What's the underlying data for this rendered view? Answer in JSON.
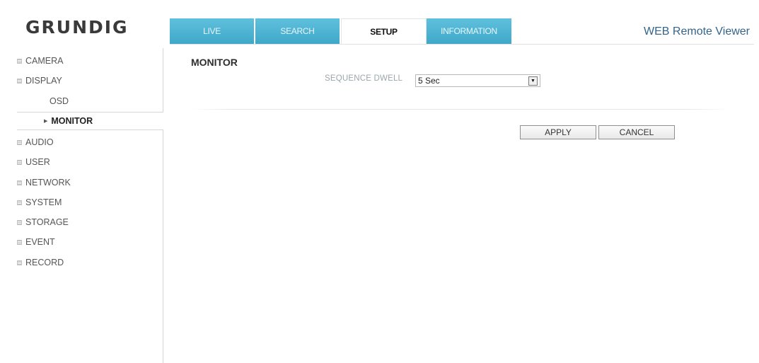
{
  "brand": {
    "logo": "GRUNDIG"
  },
  "header": {
    "tabs": [
      {
        "label": "LIVE",
        "active": false
      },
      {
        "label": "SEARCH",
        "active": false
      },
      {
        "label": "SETUP",
        "active": true
      },
      {
        "label": "INFORMATION",
        "active": false
      }
    ],
    "app_title": "WEB Remote Viewer"
  },
  "sidebar": {
    "items": [
      {
        "label": "CAMERA"
      },
      {
        "label": "DISPLAY",
        "expanded": true
      },
      {
        "label": "AUDIO"
      },
      {
        "label": "USER"
      },
      {
        "label": "NETWORK"
      },
      {
        "label": "SYSTEM"
      },
      {
        "label": "STORAGE"
      },
      {
        "label": "EVENT"
      },
      {
        "label": "RECORD"
      }
    ],
    "display_sub": [
      {
        "label": "OSD",
        "active": false
      },
      {
        "label": "MONITOR",
        "active": true
      }
    ]
  },
  "main": {
    "section_title": "MONITOR",
    "sequence_dwell": {
      "label": "SEQUENCE DWELL",
      "value": "5 Sec"
    },
    "buttons": {
      "apply": "APPLY",
      "cancel": "CANCEL"
    }
  },
  "colors": {
    "tab_blue": "#4ab3d2",
    "title_blue": "#33648a"
  }
}
